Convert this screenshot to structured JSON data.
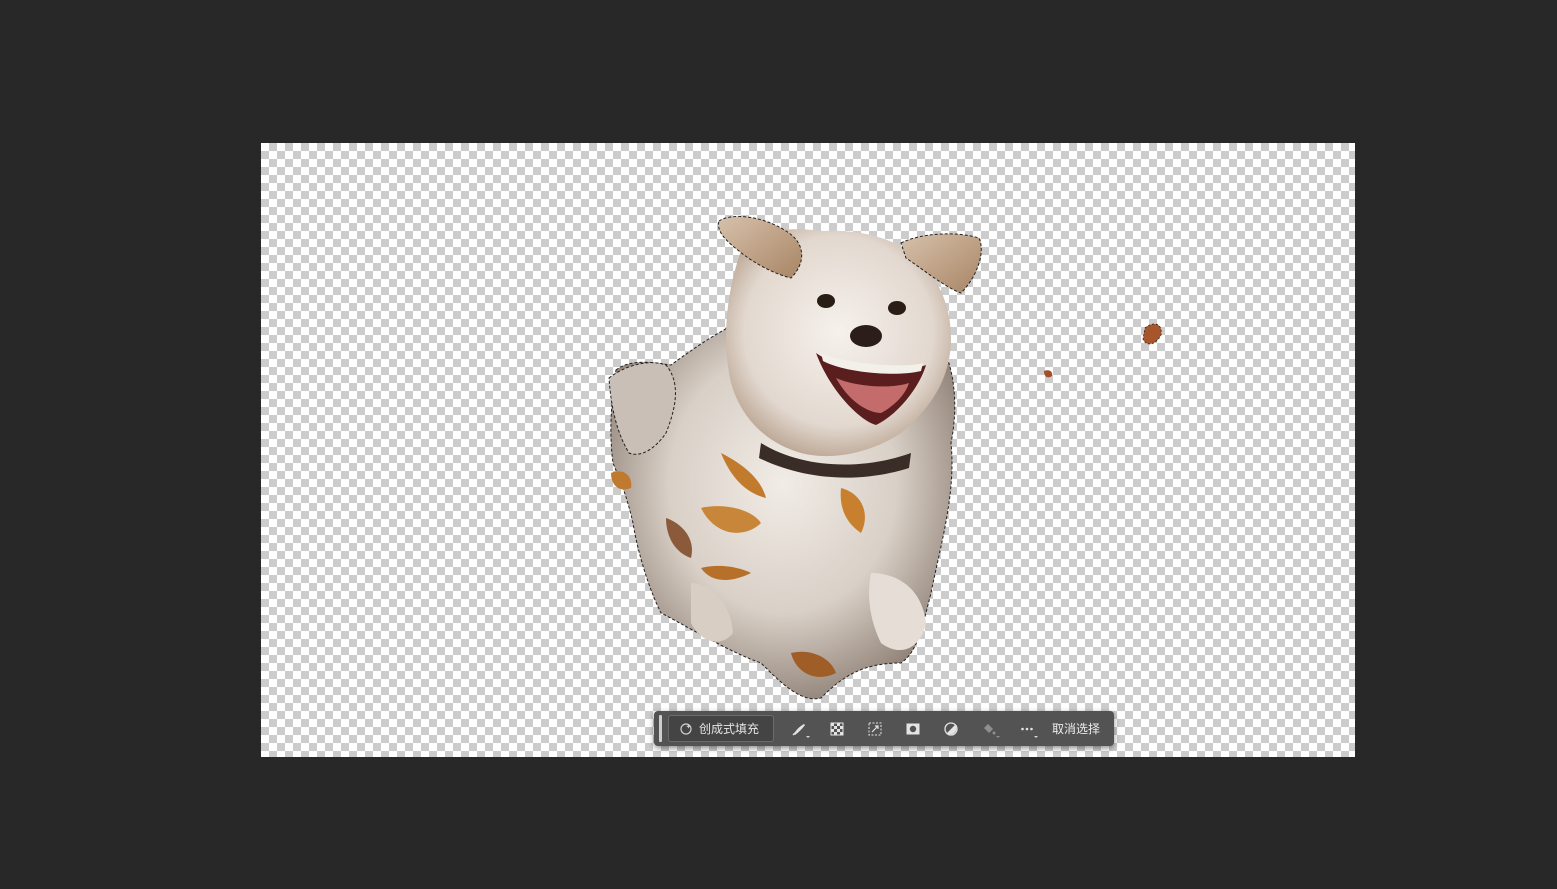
{
  "app": {
    "workspace_background": "#282828",
    "canvas_background": "transparent-checkerboard"
  },
  "canvas": {
    "content": "dog-cutout-image",
    "selection": "marching-ants-around-subject"
  },
  "taskbar": {
    "generative_fill_label": "创成式填充",
    "generative_fill_icon": "sparkle-icon",
    "tools": [
      {
        "icon": "brush-select-icon",
        "has_dropdown": true
      },
      {
        "icon": "invert-selection-icon",
        "has_dropdown": false
      },
      {
        "icon": "transform-selection-icon",
        "has_dropdown": false
      },
      {
        "icon": "mask-icon",
        "has_dropdown": false
      },
      {
        "icon": "adjustment-icon",
        "has_dropdown": false
      },
      {
        "icon": "fill-bucket-icon",
        "has_dropdown": false
      },
      {
        "icon": "more-options-icon",
        "has_dropdown": true
      }
    ],
    "deselect_label": "取消选择"
  }
}
